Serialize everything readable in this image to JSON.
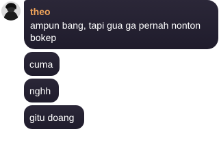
{
  "chat": {
    "sender_name": "theo",
    "sender_color": "#f0a45a",
    "bubble_color": "#231f30",
    "messages": [
      {
        "text": "ampun bang, tapi gua ga pernah nonton bokep"
      },
      {
        "text": "cuma"
      },
      {
        "text": "nghh"
      },
      {
        "text": "gitu doang"
      }
    ],
    "avatar_icon": "user-avatar-photo"
  }
}
